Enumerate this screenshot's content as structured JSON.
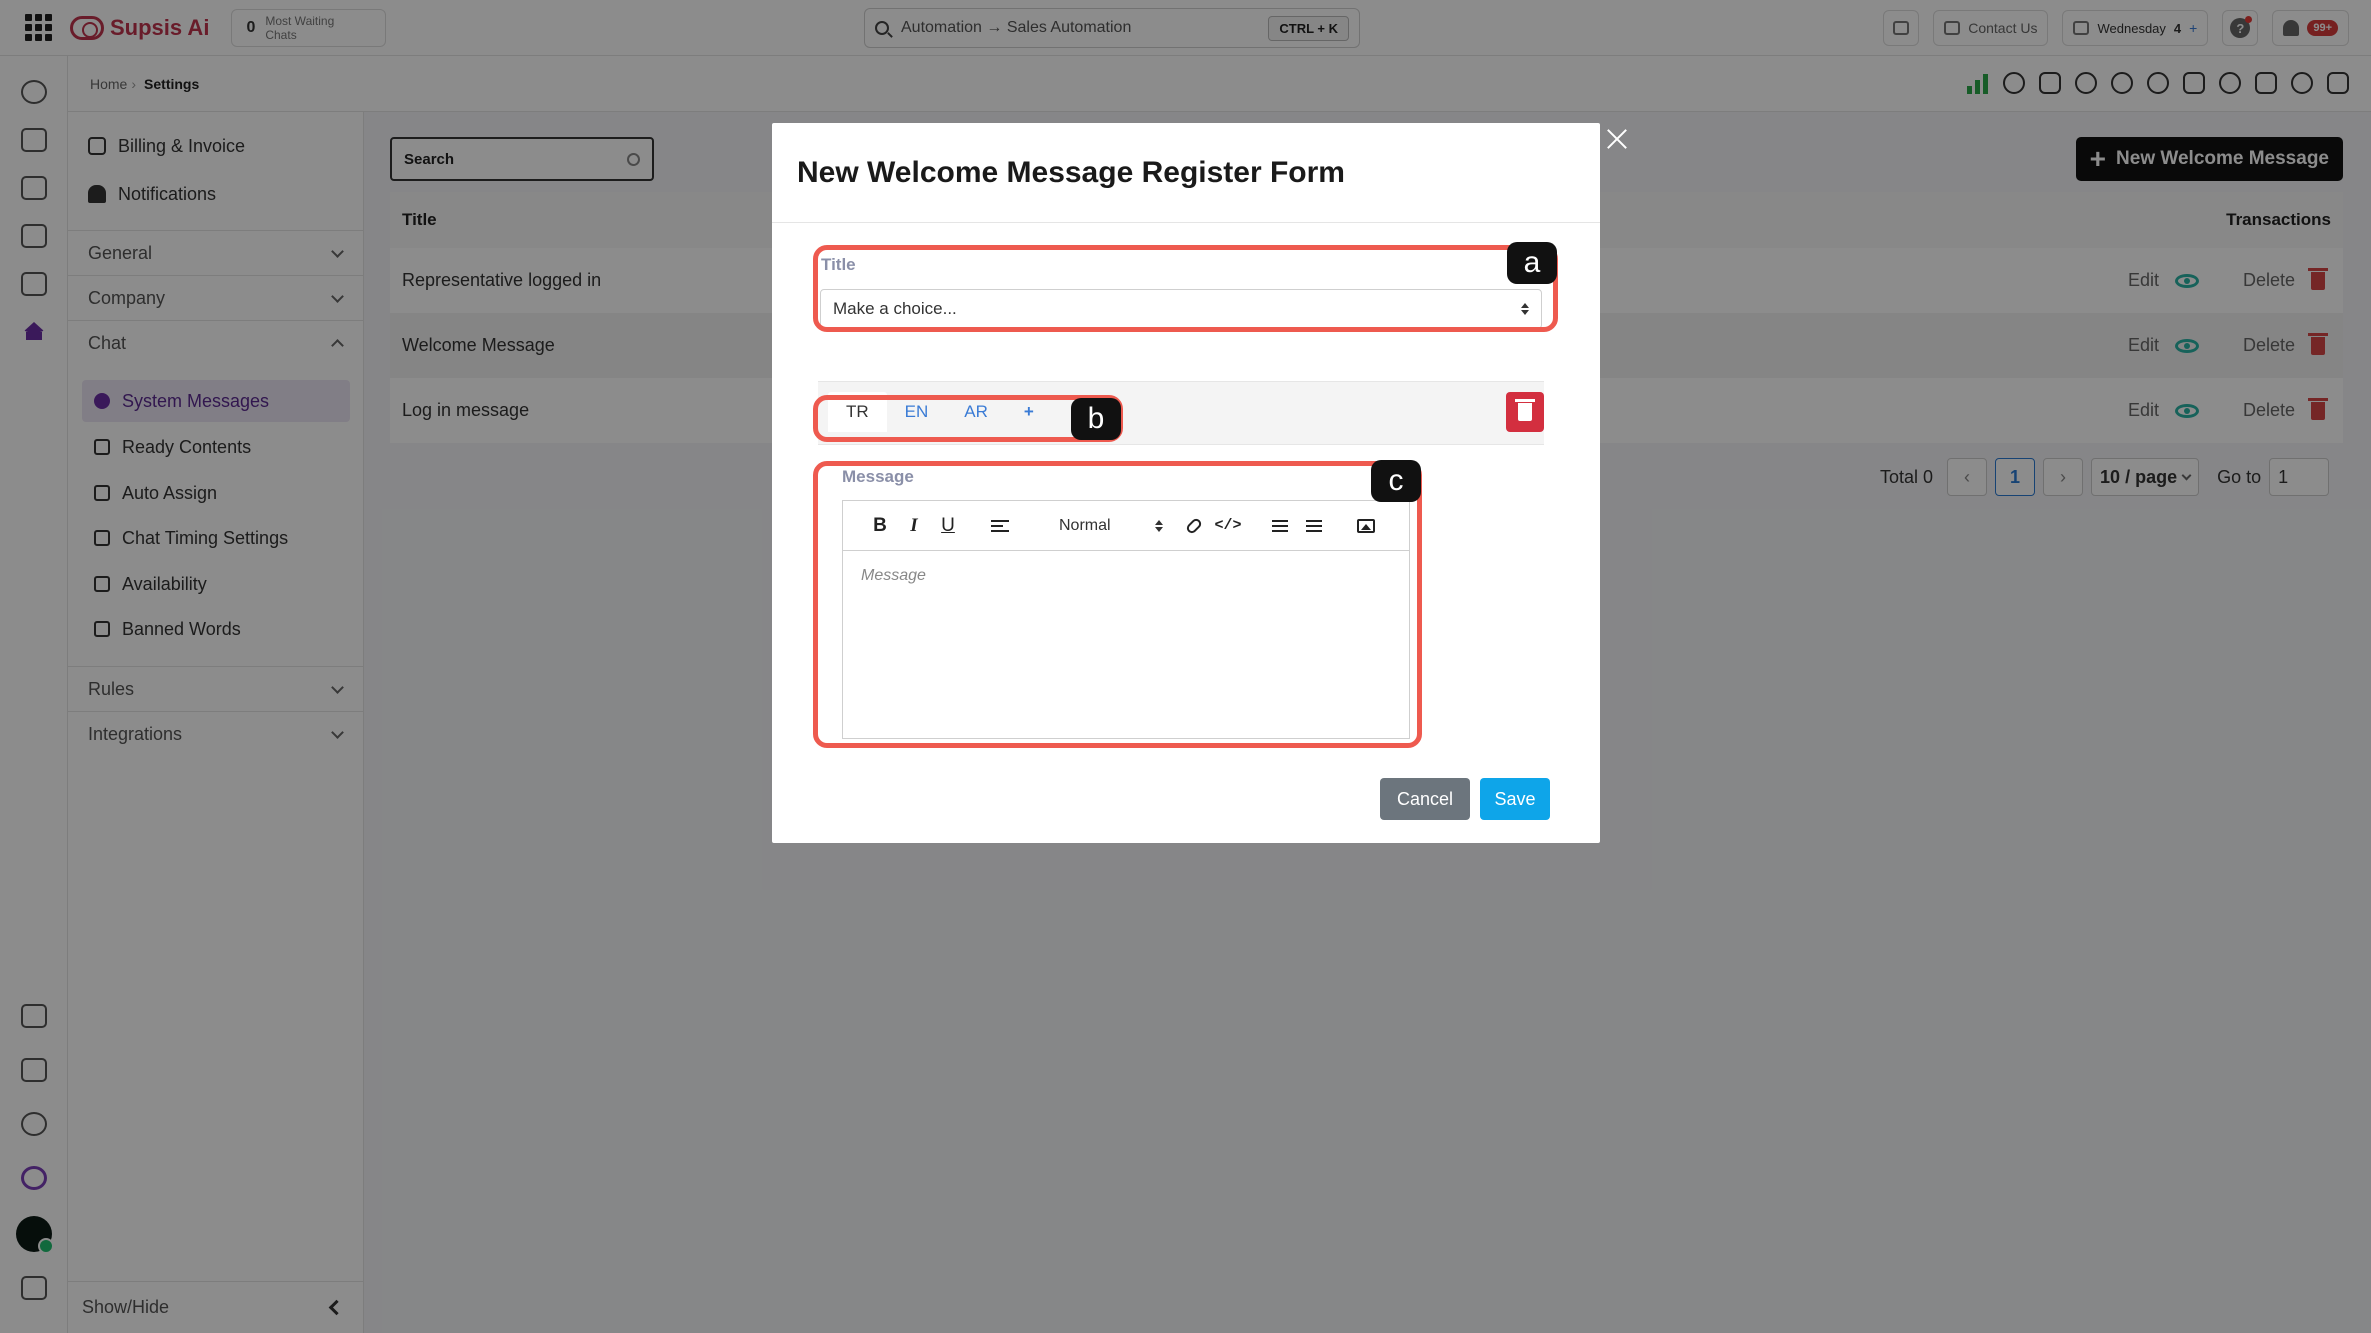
{
  "topbar": {
    "brand": "Supsis Ai",
    "waiting_count": "0",
    "waiting_label": "Most Waiting Chats",
    "search_text": "Automation → Sales Automation",
    "search_shortcut": "CTRL + K",
    "contact_label": "Contact Us",
    "day_label": "Wednesday",
    "day_number": "4",
    "day_plus": "+",
    "help_label": "?",
    "notification_badge": "99+"
  },
  "breadcrumb": {
    "home": "Home",
    "separator": "›",
    "current": "Settings"
  },
  "sidebar": {
    "top_items": [
      {
        "label": "Billing & Invoice",
        "icon": "billing-icon"
      },
      {
        "label": "Notifications",
        "icon": "bell-icon"
      }
    ],
    "groups": {
      "general": "General",
      "company": "Company",
      "chat": "Chat",
      "rules": "Rules",
      "integrations": "Integrations"
    },
    "chat_items": [
      {
        "label": "System Messages",
        "icon": "system-messages-icon",
        "active": true
      },
      {
        "label": "Ready Contents",
        "icon": "bolt-icon"
      },
      {
        "label": "Auto Assign",
        "icon": "person-icon"
      },
      {
        "label": "Chat Timing Settings",
        "icon": "hourglass-icon"
      },
      {
        "label": "Availability",
        "icon": "calendar-icon"
      },
      {
        "label": "Banned Words",
        "icon": "keyboard-icon"
      }
    ],
    "show_hide": "Show/Hide"
  },
  "main": {
    "search_label": "Search",
    "new_button": "New Welcome Message",
    "col_title": "Title",
    "col_transactions": "Transactions",
    "edit_label": "Edit",
    "delete_label": "Delete",
    "rows": [
      {
        "title": "Representative logged in"
      },
      {
        "title": "Welcome Message"
      },
      {
        "title": "Log in message"
      }
    ],
    "pagination": {
      "total": "Total 0",
      "prev": "‹",
      "page": "1",
      "next": "›",
      "page_size": "10 / page",
      "goto_label": "Go to",
      "goto_value": "1"
    }
  },
  "modal": {
    "title": "New Welcome Message Register Form",
    "title_label": "Title",
    "title_placeholder": "Make a choice...",
    "lang_tabs": [
      "TR",
      "EN",
      "AR",
      "+"
    ],
    "message_label": "Message",
    "toolbar": {
      "bold": "B",
      "italic": "I",
      "underline": "U",
      "format": "Normal",
      "code": "</>"
    },
    "message_placeholder": "Message",
    "cancel": "Cancel",
    "save": "Save"
  },
  "callouts": {
    "a": "a",
    "b": "b",
    "c": "c"
  },
  "colors": {
    "callout": "#ee5a4f",
    "save": "#0ea5e9",
    "cancel": "#6c757d",
    "delete": "#d32f3f",
    "brand": "#c0334d",
    "active_nav": "#6b2fa5"
  }
}
